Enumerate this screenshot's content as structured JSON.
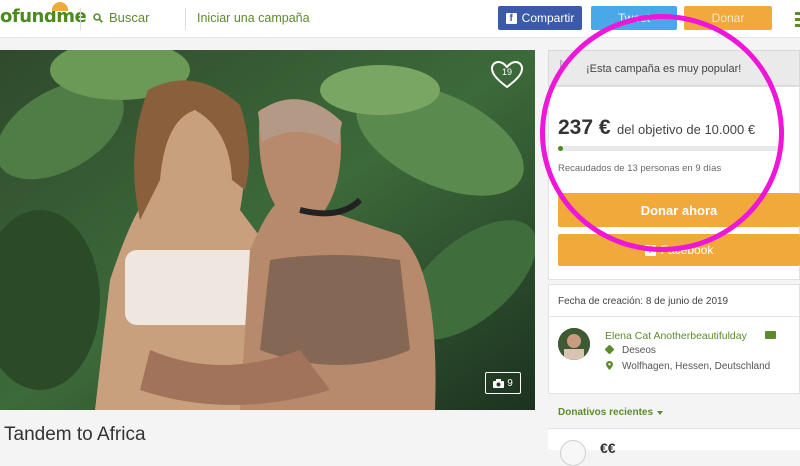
{
  "header": {
    "logo": "ofundme",
    "search_label": "Buscar",
    "start_campaign": "Iniciar una campaña",
    "share_button": "Compartir",
    "tweet_button": "Tweet",
    "donate_button": "Donar"
  },
  "campaign": {
    "title": "Tandem to Africa",
    "heart_count": "19",
    "photo_count": "9"
  },
  "sidebar": {
    "popular_text": "¡Esta campaña es muy popular!",
    "raised_amount": "237 €",
    "goal_text": "del objetivo de 10.000 €",
    "progress_fraction": 0.024,
    "raised_by": "Recaudados de 13 personas en 9 días",
    "donate_now": "Donar ahora",
    "share_facebook": "Facebook",
    "created": "Fecha de creación: 8 de junio de 2019",
    "organizer": "Elena Cat Anotherbeautifulday",
    "category": "Deseos",
    "location": "Wolfhagen, Hessen, Deutschland",
    "recent_donations": "Donativos recientes",
    "donor_mark": "€€"
  },
  "colors": {
    "brand_green": "#5c8b2e",
    "orange": "#f2a93b",
    "facebook_blue": "#3b5ba9",
    "twitter_blue": "#4aa8e8",
    "annotation_magenta": "#ee16d8"
  }
}
